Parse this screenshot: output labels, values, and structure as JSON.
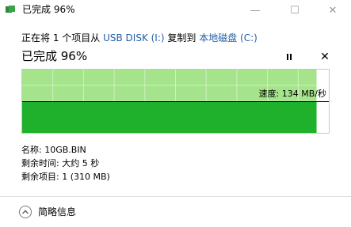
{
  "window": {
    "title": "已完成 96%",
    "minimize_glyph": "—",
    "maximize_glyph": "☐",
    "close_glyph": "✕"
  },
  "copy": {
    "prefix": "正在将 1 个项目从 ",
    "source": "USB DISK (I:)",
    "middle": " 复制到 ",
    "destination": "本地磁盘 (C:)",
    "link_color": "#1f5fa6"
  },
  "status": {
    "text": "已完成 96%",
    "percent": 96,
    "stop_glyph": "✕"
  },
  "graph": {
    "speed_label": "速度: 134 MB/秒",
    "speed_level": 0.5,
    "completed_color": "#a6e48c",
    "current_color": "#1fb02c"
  },
  "details": {
    "name": "名称: 10GB.BIN",
    "time_remaining": "剩余时间: 大约 5 秒",
    "items_remaining": "剩余项目: 1 (310 MB)"
  },
  "footer": {
    "label": "简略信息"
  }
}
